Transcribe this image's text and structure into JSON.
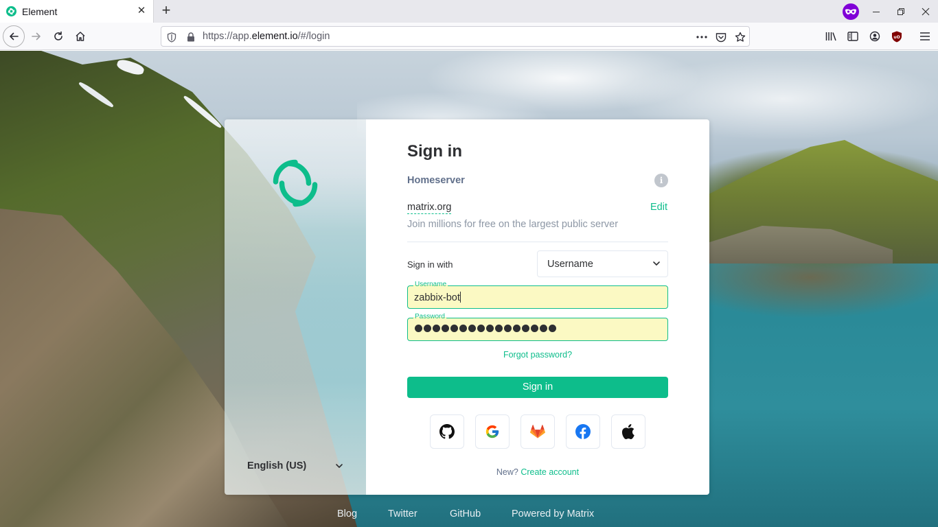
{
  "browser": {
    "tab_title": "Element",
    "url_scheme": "https://app.",
    "url_host": "element.io",
    "url_path": "/#/login"
  },
  "card": {
    "title": "Sign in",
    "homeserver_label": "Homeserver",
    "homeserver_name": "matrix.org",
    "edit_label": "Edit",
    "homeserver_description": "Join millions for free on the largest public server",
    "sign_in_with_label": "Sign in with",
    "sign_in_with_value": "Username",
    "username_legend": "Username",
    "username_value": "zabbix-bot",
    "password_legend": "Password",
    "password_length": 16,
    "forgot_password": "Forgot password?",
    "sign_in_button": "Sign in",
    "new_label": "New?",
    "create_account": "Create account",
    "language": "English (US)",
    "sso_providers": [
      "github-icon",
      "google-icon",
      "gitlab-icon",
      "facebook-icon",
      "apple-icon"
    ]
  },
  "footer": {
    "links": [
      "Blog",
      "Twitter",
      "GitHub",
      "Powered by Matrix"
    ]
  },
  "colors": {
    "accent": "#0dbd8b",
    "autofill_bg": "#fbf9c3",
    "private_badge": "#8000d7"
  }
}
